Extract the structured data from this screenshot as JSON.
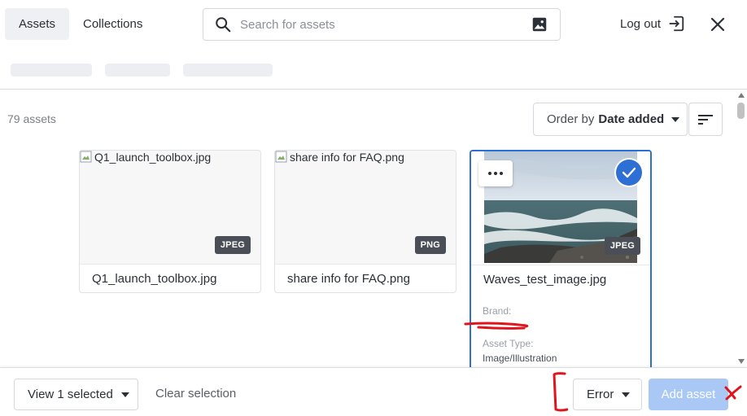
{
  "header": {
    "tabs": [
      {
        "label": "Assets",
        "active": true
      },
      {
        "label": "Collections",
        "active": false
      }
    ],
    "search": {
      "placeholder": "Search for assets",
      "value": ""
    },
    "logout_label": "Log out"
  },
  "toolbar": {
    "asset_count": "79 assets",
    "order_prefix": "Order by",
    "order_value": "Date added"
  },
  "assets": [
    {
      "name": "Q1_launch_toolbox.jpg",
      "alt": "Q1_launch_toolbox.jpg",
      "format": "JPEG",
      "selected": false
    },
    {
      "name": "share info for FAQ.png",
      "alt": "share info for FAQ.png",
      "format": "PNG",
      "selected": false
    },
    {
      "name": "Waves_test_image.jpg",
      "format": "JPEG",
      "selected": true,
      "metadata": [
        {
          "label": "Brand:",
          "value": ""
        },
        {
          "label": "Asset Type:",
          "value": "Image/Illustration"
        }
      ]
    }
  ],
  "footer": {
    "view_selected_label": "View 1 selected",
    "clear_label": "Clear selection",
    "error_label": "Error",
    "add_label": "Add asset"
  },
  "colors": {
    "accent": "#2e6fd6",
    "add_button_disabled": "#a9c8f5",
    "annotation": "#e0141c",
    "badge": "#4a4f57"
  },
  "icons": [
    "search-icon",
    "image-search-icon",
    "logout-icon",
    "close-icon",
    "chevron-down-icon",
    "sort-icon",
    "more-icon",
    "check-icon",
    "broken-image-icon"
  ]
}
